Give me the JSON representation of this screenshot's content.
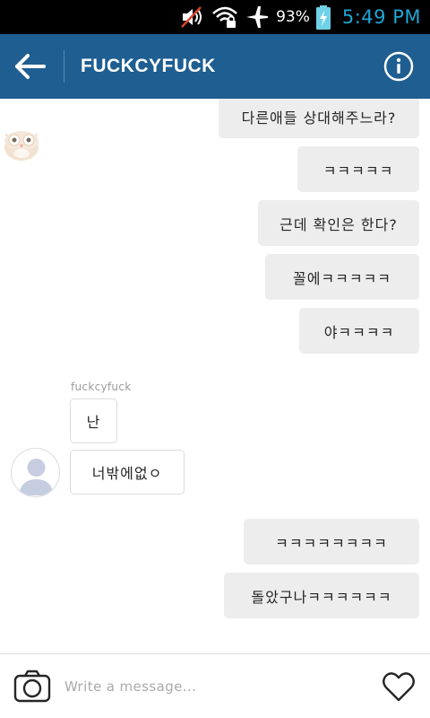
{
  "status_bar": {
    "battery_percent": "93%",
    "time": "5:49 PM",
    "icons": [
      "volume-muted-icon",
      "wifi-lock-icon",
      "airplane-icon",
      "battery-charging-icon"
    ]
  },
  "header": {
    "title": "FUCKCYFUCK",
    "back_icon": "back-arrow-icon",
    "info_icon": "info-icon",
    "bg_color": "#1f5e91"
  },
  "messages_outgoing_top": [
    "다른애들 상대해주느라?",
    "ㅋㅋㅋㅋㅋ",
    "근데 확인은 한다?",
    "꼴에ㅋㅋㅋㅋㅋ",
    "야ㅋㅋㅋㅋ"
  ],
  "incoming": {
    "sender": "fuckcyfuck",
    "messages": [
      "난",
      "너밖에없ㅇ"
    ]
  },
  "messages_outgoing_bottom": [
    "ㅋㅋㅋㅋㅋㅋㅋㅋ",
    "돌았구나ㅋㅋㅋㅋㅋㅋ"
  ],
  "composer": {
    "placeholder": "Write a message...",
    "camera_icon": "camera-icon",
    "like_icon": "heart-icon"
  }
}
